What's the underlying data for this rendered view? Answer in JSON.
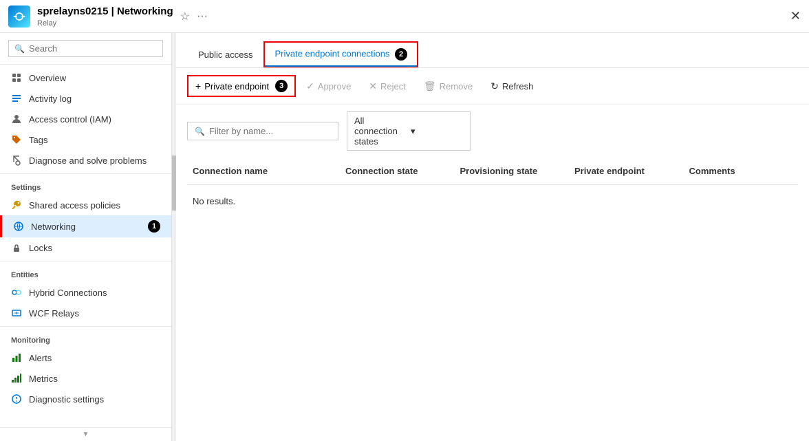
{
  "titleBar": {
    "appName": "sprelayns0215 | Networking",
    "subtitle": "Relay",
    "favoriteLabel": "☆",
    "moreLabel": "···",
    "closeLabel": "✕"
  },
  "sidebar": {
    "searchPlaceholder": "Search",
    "collapseLabel": "«",
    "navItems": [
      {
        "id": "overview",
        "label": "Overview",
        "icon": "person"
      },
      {
        "id": "activity-log",
        "label": "Activity log",
        "icon": "log"
      },
      {
        "id": "access-control",
        "label": "Access control (IAM)",
        "icon": "iam"
      },
      {
        "id": "tags",
        "label": "Tags",
        "icon": "tag"
      },
      {
        "id": "diagnose",
        "label": "Diagnose and solve problems",
        "icon": "wrench"
      }
    ],
    "sections": [
      {
        "title": "Settings",
        "items": [
          {
            "id": "shared-access",
            "label": "Shared access policies",
            "icon": "key"
          },
          {
            "id": "networking",
            "label": "Networking",
            "icon": "network",
            "active": true,
            "redBorder": true
          }
        ]
      },
      {
        "title": "",
        "items": [
          {
            "id": "locks",
            "label": "Locks",
            "icon": "lock"
          }
        ]
      },
      {
        "title": "Entities",
        "items": [
          {
            "id": "hybrid-connections",
            "label": "Hybrid Connections",
            "icon": "hybrid"
          },
          {
            "id": "wcf-relays",
            "label": "WCF Relays",
            "icon": "wcf"
          }
        ]
      },
      {
        "title": "Monitoring",
        "items": [
          {
            "id": "alerts",
            "label": "Alerts",
            "icon": "alerts"
          },
          {
            "id": "metrics",
            "label": "Metrics",
            "icon": "metrics"
          },
          {
            "id": "diagnostic-settings",
            "label": "Diagnostic settings",
            "icon": "diagnostic"
          }
        ]
      }
    ]
  },
  "content": {
    "tabs": [
      {
        "id": "public-access",
        "label": "Public access",
        "active": false
      },
      {
        "id": "private-endpoint",
        "label": "Private endpoint connections",
        "active": true,
        "badgeNum": "2"
      }
    ],
    "toolbar": {
      "buttons": [
        {
          "id": "private-endpoint-btn",
          "label": "Private endpoint",
          "icon": "+",
          "primary": true,
          "badgeNum": "3"
        },
        {
          "id": "approve-btn",
          "label": "Approve",
          "icon": "✓",
          "disabled": true
        },
        {
          "id": "reject-btn",
          "label": "Reject",
          "icon": "✕",
          "disabled": true
        },
        {
          "id": "remove-btn",
          "label": "Remove",
          "icon": "🗑",
          "disabled": true
        },
        {
          "id": "refresh-btn",
          "label": "Refresh",
          "icon": "↻",
          "disabled": false
        }
      ]
    },
    "filter": {
      "placeholder": "Filter by name...",
      "dropdownLabel": "All connection states",
      "dropdownIcon": "▾"
    },
    "table": {
      "columns": [
        "Connection name",
        "Connection state",
        "Provisioning state",
        "Private endpoint",
        "Comments"
      ],
      "noResults": "No results."
    }
  }
}
